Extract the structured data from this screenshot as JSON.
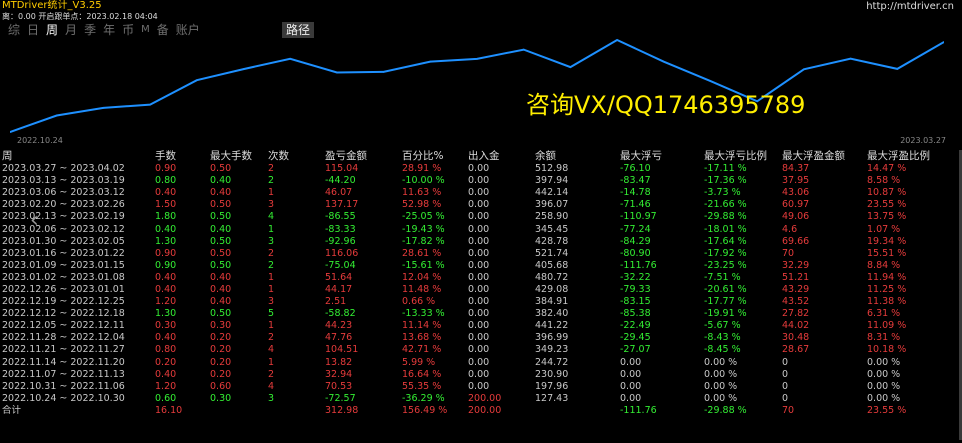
{
  "header": {
    "app_title": "MTDriver统计_V3.25",
    "site_url": "http://mtdriver.cn",
    "balance_line": "离：0.00  开启跟单点：2023.02.18 04:04"
  },
  "tabs": [
    {
      "label": "综",
      "active": false
    },
    {
      "label": "日",
      "active": false
    },
    {
      "label": "周",
      "active": true
    },
    {
      "label": "月",
      "active": false
    },
    {
      "label": "季",
      "active": false
    },
    {
      "label": "年",
      "active": false
    },
    {
      "label": "币",
      "active": false
    },
    {
      "label": "M",
      "active": false
    },
    {
      "label": "备",
      "active": false
    },
    {
      "label": "账户",
      "active": false
    }
  ],
  "path_button": "路径",
  "chart": {
    "start_date": "2022.10.24",
    "end_date": "2023.03.27",
    "line_color": "#1e90ff",
    "balance": [
      127.43,
      197.96,
      230.9,
      244.72,
      349.23,
      396.99,
      441.22,
      382.4,
      384.91,
      429.08,
      440.88,
      480.72,
      405.68,
      521.74,
      428.78,
      345.45,
      258.9,
      396.07,
      442.14,
      397.94,
      512.98
    ]
  },
  "watermark": "咨询VX/QQ1746395789",
  "nav_arrow": "‹",
  "table": {
    "columns": [
      "周",
      "手数",
      "最大手数",
      "次数",
      "盈亏金额",
      "百分比%",
      "出入金",
      "余额",
      "最大浮亏",
      "最大浮亏比例",
      "最大浮盈金额",
      "最大浮盈比例"
    ],
    "rows": [
      [
        "2023.03.27 ~ 2023.04.02",
        "0.90",
        "0.50",
        "2",
        "115.04",
        "28.91 %",
        "0.00",
        "512.98",
        "-76.10",
        "-17.11 %",
        "84.37",
        "14.47 %"
      ],
      [
        "2023.03.13 ~ 2023.03.19",
        "0.80",
        "0.40",
        "2",
        "-44.20",
        "-10.00 %",
        "0.00",
        "397.94",
        "-83.47",
        "-17.36 %",
        "37.95",
        "8.58 %"
      ],
      [
        "2023.03.06 ~ 2023.03.12",
        "0.40",
        "0.40",
        "1",
        "46.07",
        "11.63 %",
        "0.00",
        "442.14",
        "-14.78",
        "-3.73 %",
        "43.06",
        "10.87 %"
      ],
      [
        "2023.02.20 ~ 2023.02.26",
        "1.50",
        "0.50",
        "3",
        "137.17",
        "52.98 %",
        "0.00",
        "396.07",
        "-71.46",
        "-21.66 %",
        "60.97",
        "23.55 %"
      ],
      [
        "2023.02.13 ~ 2023.02.19",
        "1.80",
        "0.50",
        "4",
        "-86.55",
        "-25.05 %",
        "0.00",
        "258.90",
        "-110.97",
        "-29.88 %",
        "49.06",
        "13.75 %"
      ],
      [
        "2023.02.06 ~ 2023.02.12",
        "0.40",
        "0.40",
        "1",
        "-83.33",
        "-19.43 %",
        "0.00",
        "345.45",
        "-77.24",
        "-18.01 %",
        "4.6",
        "1.07 %"
      ],
      [
        "2023.01.30 ~ 2023.02.05",
        "1.30",
        "0.50",
        "3",
        "-92.96",
        "-17.82 %",
        "0.00",
        "428.78",
        "-84.29",
        "-17.64 %",
        "69.66",
        "19.34 %"
      ],
      [
        "2023.01.16 ~ 2023.01.22",
        "0.90",
        "0.50",
        "2",
        "116.06",
        "28.61 %",
        "0.00",
        "521.74",
        "-80.90",
        "-17.92 %",
        "70",
        "15.51 %"
      ],
      [
        "2023.01.09 ~ 2023.01.15",
        "0.90",
        "0.50",
        "2",
        "-75.04",
        "-15.61 %",
        "0.00",
        "405.68",
        "-111.76",
        "-23.25 %",
        "32.29",
        "8.84 %"
      ],
      [
        "2023.01.02 ~ 2023.01.08",
        "0.40",
        "0.40",
        "1",
        "51.64",
        "12.04 %",
        "0.00",
        "480.72",
        "-32.22",
        "-7.51 %",
        "51.21",
        "11.94 %"
      ],
      [
        "2022.12.26 ~ 2023.01.01",
        "0.40",
        "0.40",
        "1",
        "44.17",
        "11.48 %",
        "0.00",
        "429.08",
        "-79.33",
        "-20.61 %",
        "43.29",
        "11.25 %"
      ],
      [
        "2022.12.19 ~ 2022.12.25",
        "1.20",
        "0.40",
        "3",
        "2.51",
        "0.66 %",
        "0.00",
        "384.91",
        "-83.15",
        "-17.77 %",
        "43.52",
        "11.38 %"
      ],
      [
        "2022.12.12 ~ 2022.12.18",
        "1.30",
        "0.50",
        "5",
        "-58.82",
        "-13.33 %",
        "0.00",
        "382.40",
        "-85.38",
        "-19.91 %",
        "27.82",
        "6.31 %"
      ],
      [
        "2022.12.05 ~ 2022.12.11",
        "0.30",
        "0.30",
        "1",
        "44.23",
        "11.14 %",
        "0.00",
        "441.22",
        "-22.49",
        "-5.67 %",
        "44.02",
        "11.09 %"
      ],
      [
        "2022.11.28 ~ 2022.12.04",
        "0.40",
        "0.20",
        "2",
        "47.76",
        "13.68 %",
        "0.00",
        "396.99",
        "-29.45",
        "-8.43 %",
        "30.48",
        "8.31 %"
      ],
      [
        "2022.11.21 ~ 2022.11.27",
        "0.80",
        "0.20",
        "4",
        "104.51",
        "42.71 %",
        "0.00",
        "349.23",
        "-27.07",
        "-8.45 %",
        "28.67",
        "10.18 %"
      ],
      [
        "2022.11.14 ~ 2022.11.20",
        "0.20",
        "0.20",
        "1",
        "13.82",
        "5.99 %",
        "0.00",
        "244.72",
        "0.00",
        "0.00 %",
        "0",
        "0.00 %"
      ],
      [
        "2022.11.07 ~ 2022.11.13",
        "0.40",
        "0.20",
        "2",
        "32.94",
        "16.64 %",
        "0.00",
        "230.90",
        "0.00",
        "0.00 %",
        "0",
        "0.00 %"
      ],
      [
        "2022.10.31 ~ 2022.11.06",
        "1.20",
        "0.60",
        "4",
        "70.53",
        "55.35 %",
        "0.00",
        "197.96",
        "0.00",
        "0.00 %",
        "0",
        "0.00 %"
      ],
      [
        "2022.10.24 ~ 2022.10.30",
        "0.60",
        "0.30",
        "3",
        "-72.57",
        "-36.29 %",
        "200.00",
        "127.43",
        "0.00",
        "0.00 %",
        "0",
        "0.00 %"
      ]
    ],
    "total": [
      "合计",
      "16.10",
      "",
      "",
      "312.98",
      "156.49 %",
      "200.00",
      "",
      "-111.76",
      "-29.88 %",
      "70",
      "23.55 %"
    ]
  }
}
